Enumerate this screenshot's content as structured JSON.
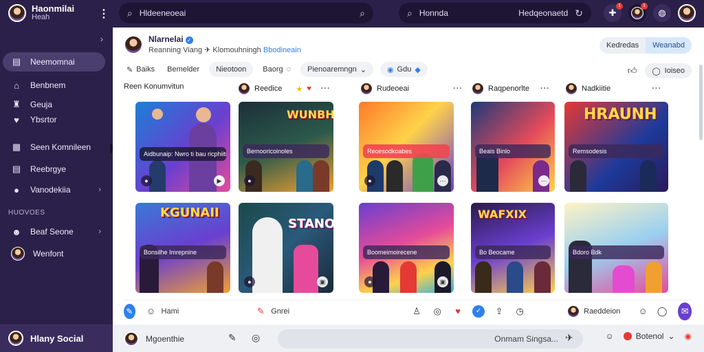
{
  "app": {
    "brand_title": "Haonmilai",
    "brand_subtitle": "Heah",
    "footer_label": "Hlany Social"
  },
  "topbar": {
    "search_left": "Hldeeneoeai",
    "search_right_label": "Honnda",
    "search_right_value": "Hedqeonaetd",
    "badges": [
      "1",
      "1"
    ]
  },
  "sidebar": {
    "items": [
      {
        "label": "Neemomnai",
        "icon": "list-icon"
      },
      {
        "label": "Benbnem",
        "icon": "home-icon"
      },
      {
        "label": "Geuja",
        "icon": "controller-icon"
      },
      {
        "label": "Ybsrtor",
        "icon": "heart-icon"
      },
      {
        "label": "Seen Komnileen",
        "icon": "grid-icon"
      },
      {
        "label": "Reebrgye",
        "icon": "document-icon"
      },
      {
        "label": "Vanodekiia",
        "icon": "emoji-icon"
      },
      {
        "label": "Beaf Seone",
        "icon": "emoji-icon"
      },
      {
        "label": "Wenfont",
        "icon": "avatar"
      }
    ],
    "section_label": "HUOVOES"
  },
  "main": {
    "profile_name": "Nlarnelai",
    "profile_sub": "Reanning Viang ✈ Klomouhningh",
    "profile_link": "Bbodineain",
    "segments": [
      "Kedredas",
      "Weanabd"
    ],
    "filters": [
      "Baiks",
      "Bemelder",
      "Nieotoon",
      "Baorg",
      "Pienoaremngn",
      "Gdu"
    ],
    "filter_right": [
      "Ioiseo"
    ],
    "column_heads": [
      "Reen Konumvitun",
      "Reedice",
      "Rudeoeai",
      "Raqpenorlte",
      "Nadkiitie"
    ],
    "cards_row1": [
      {
        "headline": "",
        "band": "Aidbunaip: Nwro ti bau ricphiitiefts"
      },
      {
        "headline": "WUNBH",
        "band": "Bemooricoinoles"
      },
      {
        "headline": "",
        "band": "Reoesodkoabes"
      },
      {
        "headline": "",
        "band": "Beais Binlo"
      },
      {
        "headline": "HRAUNH",
        "band": "Remsodesis"
      }
    ],
    "cards_row2": [
      {
        "headline": "KGUNAII",
        "band": "Bonsilhe Imrepnine"
      },
      {
        "headline": "STANOHI",
        "band": ""
      },
      {
        "headline": "",
        "band": "Boomeimoirecene"
      },
      {
        "headline": "WAFXIX",
        "band": "Bo Beocame"
      },
      {
        "headline": "",
        "band": "Bdoro Bdk"
      }
    ],
    "actions": {
      "left_label": "Hami",
      "mid_label": "Gnrei",
      "right_label": "Raeddeion"
    }
  },
  "composer": {
    "user_name": "Mgoenthie",
    "field_text": "Onmam Singsa...",
    "right_label": "Botenol"
  },
  "colors": {
    "sidebar_bg": "#2b2049",
    "accent_blue": "#2f80ed",
    "accent_purple": "#6a3fd0"
  }
}
